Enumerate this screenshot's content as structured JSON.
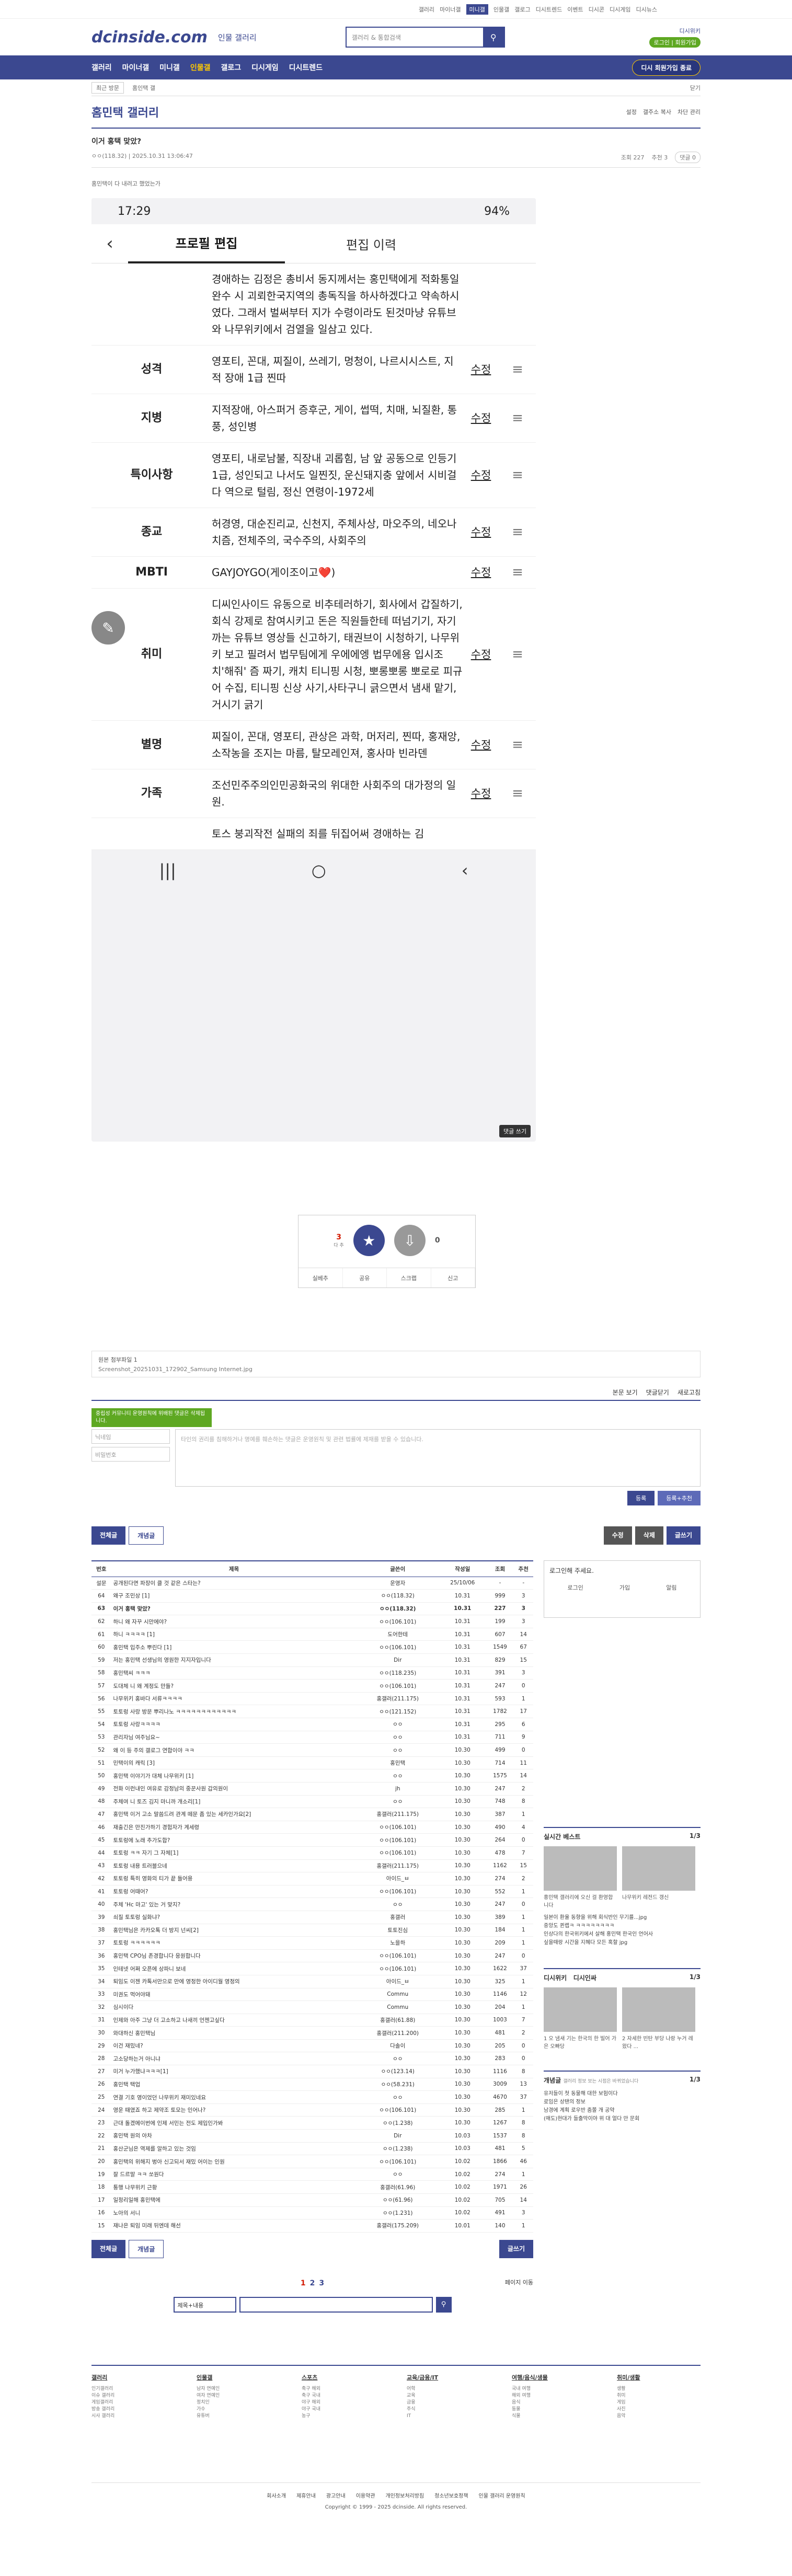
{
  "topbar": {
    "links": [
      "갤러리",
      "마이너갤",
      "미니갤",
      "인물갤",
      "갤로그",
      "디시트렌드",
      "이벤트",
      "디시콘",
      "디시게임",
      "디시뉴스"
    ],
    "minigal": "미니갤"
  },
  "logo": {
    "brand": "dcinside.com",
    "sub": "인물 갤러리",
    "search_placeholder": "갤러리 & 통합검색",
    "right1": "디시위키",
    "right2": "로그인 | 회원가입"
  },
  "gnb": {
    "items": [
      "갤러리",
      "마이너갤",
      "미니갤",
      "인물갤",
      "갤로그",
      "디시게임",
      "디시트렌드"
    ],
    "right": "디시 회원가입 종료"
  },
  "crumb": {
    "home": "최근 방문",
    "sub": "홈인택 갤",
    "close": "닫기"
  },
  "gallery": {
    "title": "홈민택 갤러리",
    "tools": [
      "설정",
      "갤주소 복사",
      "차단 관리"
    ]
  },
  "post": {
    "title": "이거 홍택 맞았?",
    "author": "ㅇㅇ(118.32)",
    "date": "2025.10.31 13:06:47",
    "views": "조회 227",
    "rec": "추천 3",
    "cmt": "댓글 0",
    "source": "홈민택이 다 내려고 했었는가"
  },
  "phone": {
    "time": "17:29",
    "status": "94%",
    "tab1": "프로필 편집",
    "tab2": "편집 이력",
    "edit": "수정",
    "rows": [
      {
        "k": "",
        "v": "경애하는 김정은 총비서 동지께서는 홍민택에게 적화통일 완수 시 괴뢰한국지역의 총독직을 하사하겠다고 약속하시였다. 그래서 벌써부터 지가 수령이라도 된것마냥 유튜브와 나무위키에서 검열을 일삼고 있다."
      },
      {
        "k": "성격",
        "v": "영포티, 꼰대, 찌질이, 쓰레기, 멍청이, 나르시시스트, 지적 장애 1급 찐따"
      },
      {
        "k": "지병",
        "v": "지적장애, 아스퍼거 증후군, 게이, 썹떡, 치매, 뇌질환, 통풍, 성인병"
      },
      {
        "k": "특이사항",
        "v": "영포티, 내로남불, 직장내 괴롭힘, 남 앞 공동으로 인등기 1급, 성인되고 나서도 일찐짓, 운신돼지충 앞에서 시비걸다 역으로 털림, 정신 연령이-1972세"
      },
      {
        "k": "종교",
        "v": "허경영, 대순진리교, 신천지, 주체사상, 마오주의, 네오나치즘, 전체주의, 국수주의, 사회주의"
      },
      {
        "k": "MBTI",
        "v": "GAYJOYGO(게이조이고❤️)"
      },
      {
        "k": "취미",
        "v": "디씨인사이드 유동으로 비추테러하기, 회사에서 갑질하기, 회식 강제로 참여시키고 돈은 직원들한테 떠넘기기, 자기 까는 유튜브 영상들 신고하기, 태권브이 시청하기, 나무위키 보고 필려서 법무팀에게 우에에엥 법무에용 입시조치'해줘' 즘 짜기, 캐치 티니핑 시청, 뽀롱뽀롱 뽀로로 피규어 수집, 티니핑 신상 사기,사타구니 긁으면서 냄새 맡기, 거시기 긁기"
      },
      {
        "k": "별명",
        "v": "찌질이, 꼰대, 영포티, 관상은 과학, 머저리, 찐따, 홍재앙, 소작농을 조지는 마름, 탈모레인져, 홍사마 빈라덴"
      },
      {
        "k": "가족",
        "v": "조선민주주의인민공화국의 위대한 사회주의 대가정의 일원."
      },
      {
        "k": "",
        "v": "토스 붕괴작전 실패의 죄를 뒤집어써 경애하는 김"
      }
    ],
    "chip": "댓글 쓰기"
  },
  "rec": {
    "up": "3",
    "up_label": "다 추",
    "down": "0",
    "btns": [
      "공유",
      "스크랩",
      "신고"
    ],
    "share": "실베추"
  },
  "attach": {
    "label": "원본 첨부파일 1",
    "file": "Screenshot_20251031_172902_Samsung Internet.jpg"
  },
  "cmt": {
    "head": [
      "본문 보기",
      "댓글닫기",
      "새로고침"
    ],
    "notice": "중립성 커뮤니티 운영원칙에 위배된 댓글은 삭제됩니다.",
    "nick_ph": "닉네임",
    "pw_ph": "비밀번호",
    "txt_ph": "타인의 권리를 침해하거나 명예를 훼손하는 댓글은 운영원칙 및 관련 법률에 제재를 받을 수 있습니다.",
    "submit": "등록",
    "submit2": "등록+추천"
  },
  "bar": {
    "all": "전체글",
    "best": "개념글",
    "edit": "수정",
    "del": "삭제",
    "write": "글쓰기"
  },
  "list": {
    "cols": [
      "번호",
      "제목",
      "글쓴이",
      "작성일",
      "조회",
      "추천"
    ],
    "rows": [
      [
        "설문",
        "공개된다면 파장이 클 것 같은 스타는?",
        "운영자",
        "25/10/06",
        "-",
        "-"
      ],
      [
        "64",
        "왜구 조민상 [1]",
        "ㅇㅇ(118.32)",
        "10.31",
        "999",
        "3"
      ],
      [
        "63",
        "이거 홍택 맞았?",
        "ㅇㅇ(118.32)",
        "10.31",
        "227",
        "3"
      ],
      [
        "62",
        "하니 왜 자꾸 시만에야?",
        "ㅇㅇ(106.101)",
        "10.31",
        "199",
        "3"
      ],
      [
        "61",
        "하니 ㅋㅋㅋㅋ [1]",
        "도어한테",
        "10.31",
        "607",
        "14"
      ],
      [
        "60",
        "홍민택 입주소 뿌린다 [1]",
        "ㅇㅇ(106.101)",
        "10.31",
        "1549",
        "67"
      ],
      [
        "59",
        "저는 홍민택 선생님의 영원한 지지자입니다",
        "Dir",
        "10.31",
        "829",
        "15"
      ],
      [
        "58",
        "홍민택씨 ㅋㅋㅋ",
        "ㅇㅇ(118.235)",
        "10.31",
        "391",
        "3"
      ],
      [
        "57",
        "도대체 니 왜 계정도 만들?",
        "ㅇㅇ(106.101)",
        "10.31",
        "247",
        "0"
      ],
      [
        "56",
        "나무위키 홍바다 서류ㅋㅋㅋㅋ",
        "홍갤러(211.175)",
        "10.31",
        "593",
        "1"
      ],
      [
        "55",
        "토토렁 사랑 방문 뿌리나노 ㅋㅋㅋㅋㅋㅋㅋㅋㅋㅋㅋㅋ",
        "ㅇㅇ(121.152)",
        "10.31",
        "1782",
        "17"
      ],
      [
        "54",
        "토토렁 사랑ㅋㅋㅋㅋ",
        "ㅇㅇ",
        "10.31",
        "295",
        "6"
      ],
      [
        "53",
        "관리자님 여주님요~",
        "ㅇㅇ",
        "10.31",
        "711",
        "9"
      ],
      [
        "52",
        "왜 이 등 주의 갤로그 연합이야 ㅋㅋ",
        "ㅇㅇ",
        "10.30",
        "499",
        "0"
      ],
      [
        "51",
        "민택이의 캐릭 [3]",
        "홍민택",
        "10.30",
        "714",
        "11"
      ],
      [
        "50",
        "홍민택 이야기가 대체 나무위키 [1]",
        "ㅇㅇ",
        "10.30",
        "1575",
        "14"
      ],
      [
        "49",
        "전화 이런내인 여유로 감정남의 중꾼사원 갑의원이",
        "jh",
        "10.30",
        "247",
        "2"
      ],
      [
        "48",
        "주체여 니 토즈 김지 마니까 개소리[1]",
        "ㅇㅇ",
        "10.30",
        "748",
        "8"
      ],
      [
        "47",
        "홍민택 이거 고소 말씀드려 관계 떼문 좀 있는 세카인가요[2]",
        "홍갤러(211.175)",
        "10.30",
        "387",
        "1"
      ],
      [
        "46",
        "재출긴은 만진가하기 경험자가 계세령",
        "ㅇㅇ(106.101)",
        "10.30",
        "490",
        "4"
      ],
      [
        "45",
        "토토렁에 노래 추가도합?",
        "ㅇㅇ(106.101)",
        "10.30",
        "264",
        "0"
      ],
      [
        "44",
        "토토렁 ㅋㅋ 자기 그 자체[1]",
        "ㅇㅇ(106.101)",
        "10.30",
        "478",
        "7"
      ],
      [
        "43",
        "토토렁 내용 트러블으네",
        "홍갤러(211.175)",
        "10.30",
        "1162",
        "15"
      ],
      [
        "42",
        "토토렁 특히 영화의 티가 끝 들어용",
        "아이드_ㅂ",
        "10.30",
        "274",
        "2"
      ],
      [
        "41",
        "토토렁 어때어?",
        "ㅇㅇ(106.101)",
        "10.30",
        "552",
        "1"
      ],
      [
        "40",
        "주체 'Hc 마고' 있는 거 맞지?",
        "ㅇㅇ",
        "10.30",
        "247",
        "0"
      ],
      [
        "39",
        "쇠질 토토렁 실화냐?",
        "홍갤러",
        "10.30",
        "389",
        "1"
      ],
      [
        "38",
        "홍민택님은 카카오톡 더 방지 넌씨[2]",
        "토토진심",
        "10.30",
        "184",
        "1"
      ],
      [
        "37",
        "토토렁 ㅋㅋㅋㅋㅋㅋ",
        "노을하",
        "10.30",
        "209",
        "1"
      ],
      [
        "36",
        "홍민택 CPO님 존경합니다 응원합니다",
        "ㅇㅇ(106.101)",
        "10.30",
        "247",
        "0"
      ],
      [
        "35",
        "인테넷 어쩌 오픈에 상파니 보네",
        "ㅇㅇ(106.101)",
        "10.30",
        "1622",
        "37"
      ],
      [
        "34",
        "퇴임도 이젠 카톡서만으로 만에 영정한 아이디월 영정의",
        "아이드_ㅂ",
        "10.30",
        "325",
        "1"
      ],
      [
        "33",
        "미권도 먹어야돼",
        "Commu",
        "10.30",
        "1146",
        "12"
      ],
      [
        "32",
        "심시이다",
        "Commu",
        "10.30",
        "204",
        "1"
      ],
      [
        "31",
        "인제와 아주 그냥 더 고소하고 나새끼 언젠고싶다",
        "홍갤러(61.88)",
        "10.30",
        "1003",
        "7"
      ],
      [
        "30",
        "와대하신 홍민택님",
        "홍갤러(211.200)",
        "10.30",
        "481",
        "2"
      ],
      [
        "29",
        "이건 재밌네?",
        "다솔이",
        "10.30",
        "205",
        "0"
      ],
      [
        "28",
        "고소당하는거 아니냐",
        "ㅇㅇ",
        "10.30",
        "283",
        "0"
      ],
      [
        "27",
        "미거 누가했냐ㅋㅋㅋ[1]",
        "ㅇㅇ(123.14)",
        "10.30",
        "1116",
        "8"
      ],
      [
        "26",
        "홍민택 택업",
        "ㅇㅇ(58.231)",
        "10.30",
        "3009",
        "13"
      ],
      [
        "25",
        "연결 기호 영이었던 나무위키 재미있네요",
        "ㅇㅇ",
        "10.30",
        "4670",
        "37"
      ],
      [
        "24",
        "영운 때였죠 하고 제약조 토모는 인어나?",
        "ㅇㅇ(106.101)",
        "10.30",
        "285",
        "1"
      ],
      [
        "23",
        "근대 돌겠메이번에 인제 서민는 전도 제입인가봐",
        "ㅇㅇ(1.238)",
        "10.30",
        "1267",
        "8"
      ],
      [
        "22",
        "홍민택 원의 아차",
        "Dir",
        "10.03",
        "1537",
        "8"
      ],
      [
        "21",
        "홍산군님은 역제를 알하고 있는 것임",
        "ㅇㅇ(1.238)",
        "10.03",
        "481",
        "5"
      ],
      [
        "20",
        "홍민택의 위해지 벙아 신고되서 재밌 어이는 인원",
        "ㅇㅇ(106.101)",
        "10.02",
        "1866",
        "46"
      ],
      [
        "19",
        "잘 드르말 ㅋㅋ 쏘원다",
        "ㅇㅇ",
        "10.02",
        "274",
        "1"
      ],
      [
        "18",
        "통행 나무위키 근황",
        "홍갤러(61.96)",
        "10.02",
        "1971",
        "26"
      ],
      [
        "17",
        "일정리일해 홍민택에",
        "ㅇㅇ(61.96)",
        "10.02",
        "705",
        "14"
      ],
      [
        "16",
        "노아의 서니",
        "ㅇㅇ(1.231)",
        "10.02",
        "491",
        "3"
      ],
      [
        "15",
        "재나은 퇴임 미래 뒤엔데 해선",
        "홍갤러(175.209)",
        "10.01",
        "140",
        "1"
      ]
    ]
  },
  "side": {
    "login_title": "로그인해 주세요.",
    "login_items": [
      "로그인",
      "가입",
      "알림"
    ],
    "sec1": "실시간 베스트",
    "sec1_page": "1/3",
    "sec1_caps": [
      "홍민택 갤러리에 오신 걸 환영합니다",
      "나무위키 레전드 갱신"
    ],
    "sec1_lines": [
      "일본이 환율 동향을 위해 회식반인 무기를...jpg",
      "중앙도 퀸랩ㅋ ㅋㅋㅋㅋㅋㅋㅋㅋ",
      "인상다의 한국위키에서 살해 홍민택 한국인 언어사",
      "싶을때랑 시간을 지혜다 모든 혹할 jpg"
    ],
    "sec2": "디시위키",
    "sec2b": "디시인싸",
    "sec2_page": "1/3",
    "sec2_caps": [
      "1 오 냄새 기는 한국의 한 빌어 가은 오빠당",
      "2 자세한 빈탄 부당 나랑 누거 레왔다 ..."
    ],
    "sec3": "개념글",
    "sec3_note": "갤러리 정보 보는 시점은 바뀌었습니다",
    "sec3_page": "1/3",
    "sec3_lines": [
      "유저들이 첫 동물해 대한 보험이다",
      "로임은 상탠의 정보",
      "남경에 계획 로우반 줌쫄 개 공약",
      "(매도)현대가 들출막이야 위 대 얼다 만 문회"
    ]
  },
  "pager": {
    "pages": [
      "1",
      "2",
      "3"
    ],
    "mini": "페이지 이동"
  },
  "search2": {
    "sel": "제목+내용"
  },
  "footer": {
    "cols": [
      {
        "h": "갤러리",
        "i": [
          "인기갤러리",
          "이슈 갤러리",
          "게임갤러리",
          "방송 갤러리",
          "시사 갤러리"
        ]
      },
      {
        "h": "인물갤",
        "i": [
          "남자 연예인",
          "여자 연예인",
          "정치인",
          "가수",
          "유튜버"
        ]
      },
      {
        "h": "스포츠",
        "i": [
          "축구 해외",
          "축구 국내",
          "야구 해외",
          "야구 국내",
          "농구"
        ]
      },
      {
        "h": "교육/금융/IT",
        "i": [
          "어학",
          "교육",
          "금융",
          "주식",
          "IT"
        ]
      },
      {
        "h": "여행/음식/생물",
        "i": [
          "국내 여행",
          "해외 여행",
          "음식",
          "동물",
          "식물"
        ]
      },
      {
        "h": "취미/생활",
        "i": [
          "생활",
          "취미",
          "게임",
          "사진",
          "음악"
        ]
      }
    ],
    "links": [
      "회사소개",
      "제휴안내",
      "광고안내",
      "이용약관",
      "개인정보처리방침",
      "청소년보호정책",
      "인물 갤러리 운영원칙"
    ],
    "copy": "Copyright © 1999 - 2025 dcinside. All rights reserved."
  }
}
